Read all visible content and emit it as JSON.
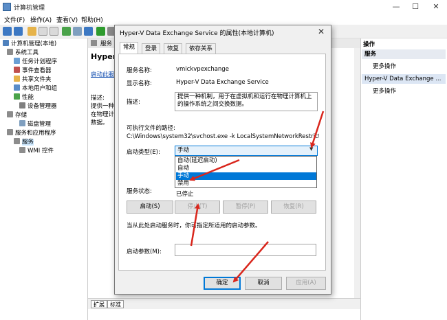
{
  "window": {
    "title": "计算机管理",
    "minimize": "—",
    "maximize": "☐",
    "close": "✕"
  },
  "menu": [
    "文件(F)",
    "操作(A)",
    "查看(V)",
    "帮助(H)"
  ],
  "tree": {
    "items": [
      {
        "label": "计算机管理(本地)",
        "icon": "computer-icon",
        "color": "#4f81bd"
      },
      {
        "label": "系统工具",
        "icon": "tools-icon",
        "color": "#8c8c8c"
      },
      {
        "label": "任务计划程序",
        "icon": "clock-icon",
        "color": "#6a9fd4"
      },
      {
        "label": "事件查看器",
        "icon": "event-icon",
        "color": "#c0504d"
      },
      {
        "label": "共享文件夹",
        "icon": "folder-icon",
        "color": "#e6b34a"
      },
      {
        "label": "本地用户和组",
        "icon": "users-icon",
        "color": "#5a8dc8"
      },
      {
        "label": "性能",
        "icon": "performance-icon",
        "color": "#4aa34a"
      },
      {
        "label": "设备管理器",
        "icon": "device-icon",
        "color": "#7f7f7f"
      },
      {
        "label": "存储",
        "icon": "storage-icon",
        "color": "#8c8c8c"
      },
      {
        "label": "磁盘管理",
        "icon": "disk-icon",
        "color": "#7f9fbf"
      },
      {
        "label": "服务和应用程序",
        "icon": "services-apps-icon",
        "color": "#8c8c8c"
      },
      {
        "label": "服务",
        "icon": "gear-icon",
        "color": "#8c8c8c"
      },
      {
        "label": "WMI 控件",
        "icon": "wmi-icon",
        "color": "#8c8c8c"
      }
    ]
  },
  "middle": {
    "header": "服务",
    "service_title": "Hyper-V",
    "start_link": "启动此服务",
    "desc_label": "描述:",
    "desc_lines": [
      "提供一种机",
      "在物理计算机",
      "数据。"
    ],
    "tabs": [
      "扩展",
      "标准"
    ]
  },
  "right": {
    "header": "操作",
    "section1": "服务",
    "more1": "更多操作",
    "section2": "Hyper-V Data Exchange ...",
    "more2": "更多操作"
  },
  "dialog": {
    "title": "Hyper-V Data Exchange Service 的属性(本地计算机)",
    "close": "✕",
    "tabs": [
      "常规",
      "登录",
      "恢复",
      "依存关系"
    ],
    "service_name_label": "服务名称:",
    "service_name": "vmickvpexchange",
    "display_name_label": "显示名称:",
    "display_name": "Hyper-V Data Exchange Service",
    "description_label": "描述:",
    "description": "提供一种机制，用于在虚拟机和运行在物理计算机上的操作系统之间交换数据。",
    "exe_path_label": "可执行文件的路径:",
    "exe_path": "C:\\Windows\\system32\\svchost.exe -k LocalSystemNetworkRestricted -p",
    "startup_type_label": "启动类型(E):",
    "startup_type_value": "手动",
    "startup_options": [
      "自动(延迟启动)",
      "自动",
      "手动",
      "禁用"
    ],
    "startup_selected_index": 2,
    "status_label": "服务状态:",
    "status_value": "已停止",
    "btn_start": "启动(S)",
    "btn_stop": "停止(T)",
    "btn_pause": "暂停(P)",
    "btn_resume": "恢复(R)",
    "hint": "当从此处启动服务时，你可指定所适用的启动参数。",
    "params_label": "启动参数(M):",
    "params_value": "",
    "btn_ok": "确定",
    "btn_cancel": "取消",
    "btn_apply": "应用(A)"
  },
  "annotation_color": "#d9261c"
}
